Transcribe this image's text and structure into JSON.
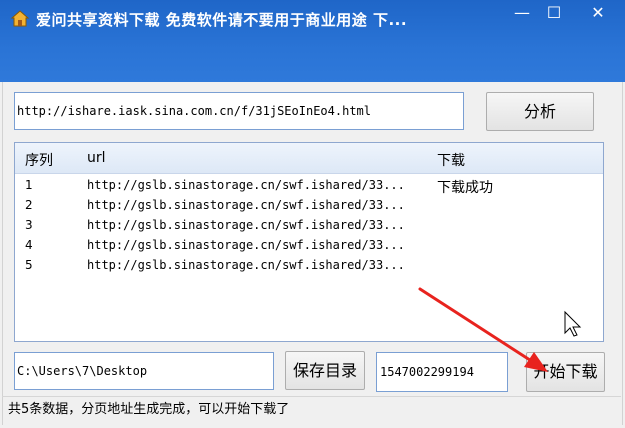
{
  "window": {
    "title": "爱问共享资料下载 免费软件请不要用于商业用途 下...",
    "controls": {
      "minimize": "—",
      "maximize": "☐",
      "close": "✕"
    }
  },
  "url_input": {
    "value": "http://ishare.iask.sina.com.cn/f/31jSEoInEo4.html"
  },
  "analyze_button": {
    "label": "分析"
  },
  "list": {
    "columns": [
      "序列",
      "url",
      "下载"
    ],
    "rows": [
      {
        "index": "1",
        "url": "http://gslb.sinastorage.cn/swf.ishared/33...",
        "status": "下载成功"
      },
      {
        "index": "2",
        "url": "http://gslb.sinastorage.cn/swf.ishared/33...",
        "status": ""
      },
      {
        "index": "3",
        "url": "http://gslb.sinastorage.cn/swf.ishared/33...",
        "status": ""
      },
      {
        "index": "4",
        "url": "http://gslb.sinastorage.cn/swf.ishared/33...",
        "status": ""
      },
      {
        "index": "5",
        "url": "http://gslb.sinastorage.cn/swf.ishared/33...",
        "status": ""
      }
    ]
  },
  "save_dir": {
    "value": "C:\\Users\\7\\Desktop"
  },
  "save_dir_button": {
    "label": "保存目录"
  },
  "number_input": {
    "value": "1547002299194"
  },
  "start_button": {
    "label": "开始下载"
  },
  "status_bar": {
    "text": "共5条数据，分页地址生成完成，可以开始下载了"
  },
  "colors": {
    "titlebar": "#2a74d6",
    "arrow": "#e8231e"
  },
  "icons": [
    "app-icon",
    "minimize-icon",
    "maximize-icon",
    "close-icon",
    "mouse-cursor-icon",
    "red-arrow-annotation"
  ]
}
